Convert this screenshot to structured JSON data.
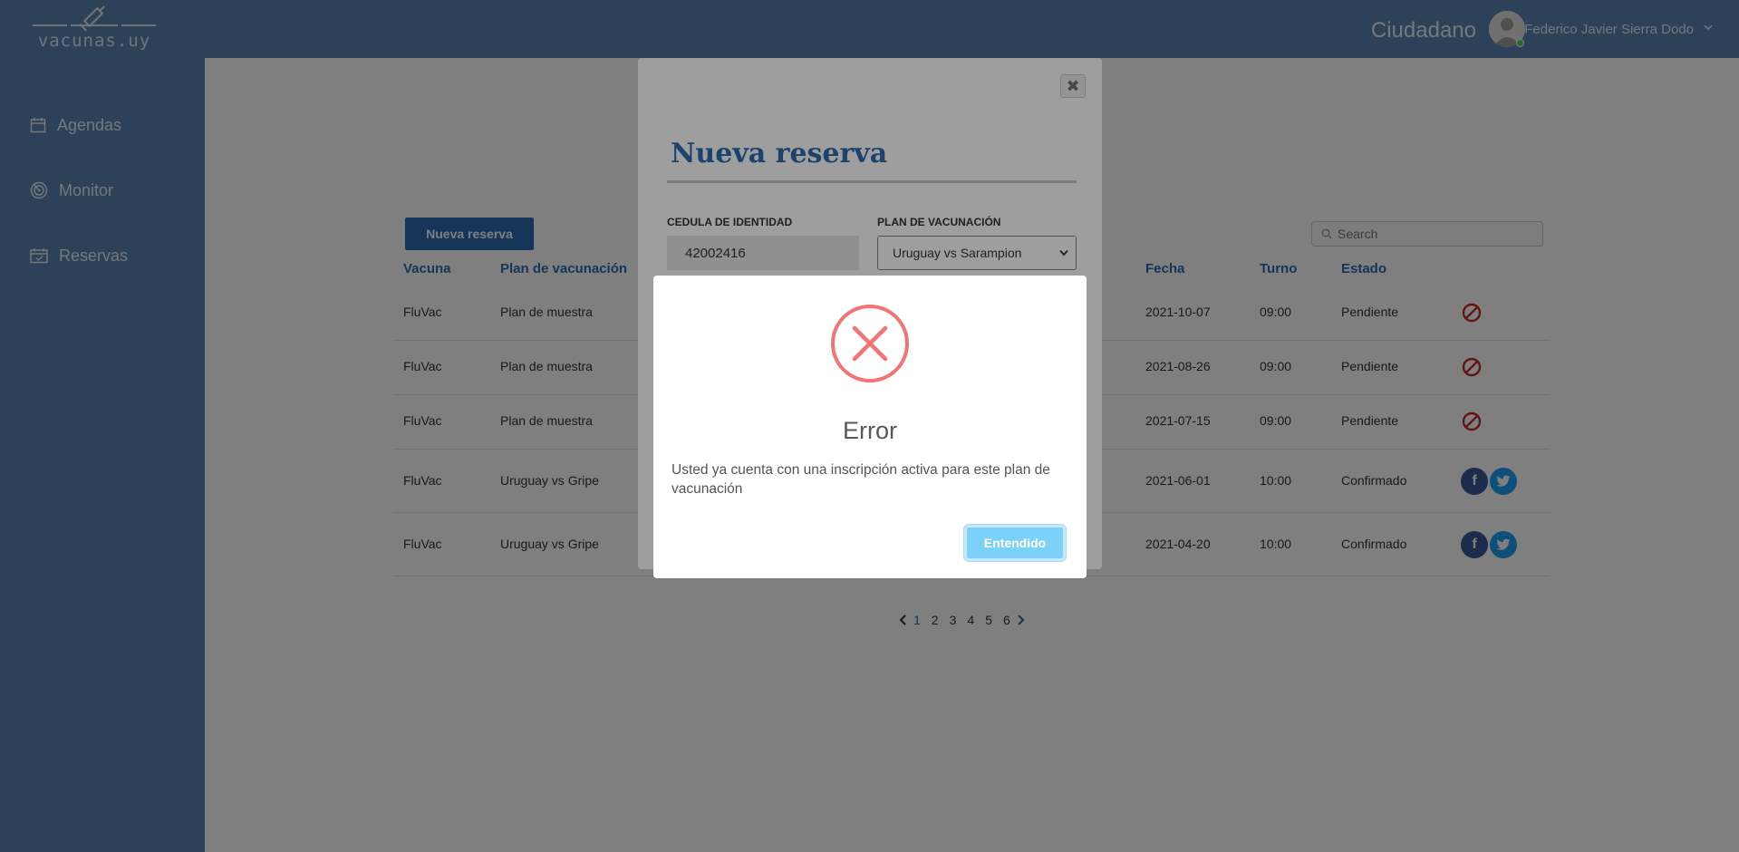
{
  "app": {
    "logo_text": "vacunas.uy",
    "role": "Ciudadano",
    "user_name": "Federico Javier Sierra Dodo"
  },
  "sidebar": {
    "items": [
      {
        "label": "Agendas",
        "icon": "calendar-icon"
      },
      {
        "label": "Monitor",
        "icon": "monitor-icon"
      },
      {
        "label": "Reservas",
        "icon": "calendar-check-icon"
      }
    ]
  },
  "toolbar": {
    "new_button": "Nueva reserva",
    "search_placeholder": "Search"
  },
  "table": {
    "headers": {
      "vacuna": "Vacuna",
      "plan": "Plan de vacunación",
      "fecha": "Fecha",
      "turno": "Turno",
      "estado": "Estado"
    },
    "rows": [
      {
        "vacuna": "FluVac",
        "plan": "Plan de muestra",
        "fecha": "2021-10-07",
        "turno": "09:00",
        "estado": "Pendiente",
        "action": "cancel-icon"
      },
      {
        "vacuna": "FluVac",
        "plan": "Plan de muestra",
        "fecha": "2021-08-26",
        "turno": "09:00",
        "estado": "Pendiente",
        "action": "cancel-icon"
      },
      {
        "vacuna": "FluVac",
        "plan": "Plan de muestra",
        "fecha": "2021-07-15",
        "turno": "09:00",
        "estado": "Pendiente",
        "action": "cancel-icon"
      },
      {
        "vacuna": "FluVac",
        "plan": "Uruguay vs Gripe",
        "fecha": "2021-06-01",
        "turno": "10:00",
        "estado": "Confirmado",
        "action": "share-icons"
      },
      {
        "vacuna": "FluVac",
        "plan": "Uruguay vs Gripe",
        "fecha": "2021-04-20",
        "turno": "10:00",
        "estado": "Confirmado",
        "action": "share-icons"
      }
    ]
  },
  "pagination": {
    "pages": [
      "1",
      "2",
      "3",
      "4",
      "5",
      "6"
    ],
    "current": "1"
  },
  "reserva_modal": {
    "title": "Nueva reserva",
    "cedula_label": "CEDULA DE IDENTIDAD",
    "cedula_value": "42002416",
    "plan_label": "PLAN DE VACUNACIÓN",
    "plan_value": "Uruguay vs Sarampion"
  },
  "error_dialog": {
    "title": "Error",
    "message": "Usted ya cuenta con una inscripción activa para este plan de vacunación",
    "confirm_button": "Entendido"
  },
  "colors": {
    "sidebar": "#5b82b3",
    "primary": "#2b6cb0",
    "error": "#f27474",
    "confirm": "#7cd1f9",
    "facebook": "#3b5998",
    "twitter": "#1da1f2",
    "cancel": "#c62828"
  }
}
